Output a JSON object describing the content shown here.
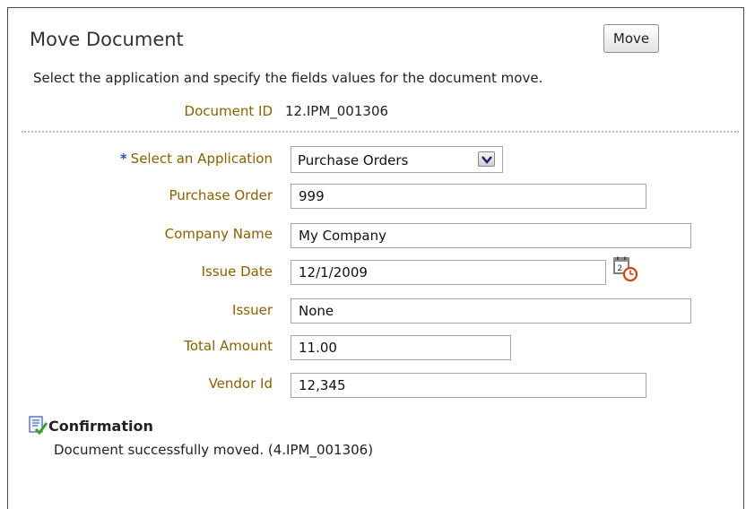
{
  "header": {
    "title": "Move Document",
    "move_button_label": "Move",
    "instructions": "Select the application and specify the fields values for the document move."
  },
  "document": {
    "id_label": "Document ID",
    "id_value": "12.IPM_001306"
  },
  "form": {
    "application": {
      "required_marker": "*",
      "label": "Select an Application",
      "value": "Purchase Orders"
    },
    "purchase_order": {
      "label": "Purchase Order",
      "value": "999"
    },
    "company_name": {
      "label": "Company Name",
      "value": "My Company"
    },
    "issue_date": {
      "label": "Issue Date",
      "value": "12/1/2009"
    },
    "issuer": {
      "label": "Issuer",
      "value": "None"
    },
    "total_amount": {
      "label": "Total Amount",
      "value": "11.00"
    },
    "vendor_id": {
      "label": "Vendor Id",
      "value": "12,345"
    }
  },
  "confirmation": {
    "title": "Confirmation",
    "message": "Document successfully moved. (4.IPM_001306)"
  },
  "icons": {
    "dropdown": "chevron-down-icon",
    "calendar": "calendar-clock-icon",
    "confirmation": "document-check-icon"
  },
  "colors": {
    "label": "#8a6100",
    "required_marker": "#2a4fb8",
    "success_check": "#3aa02c"
  }
}
